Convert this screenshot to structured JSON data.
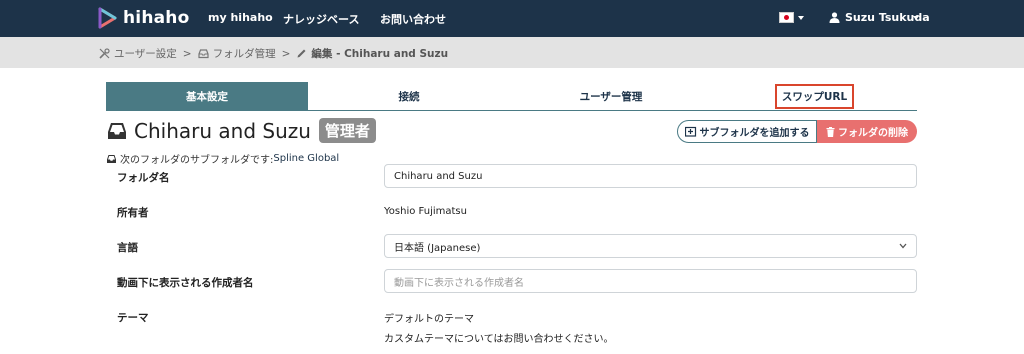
{
  "app": {
    "logo_text": "hihaho"
  },
  "topnav": {
    "links": [
      "my hihaho",
      "ナレッジベース",
      "お問い合わせ"
    ],
    "user_name": "Suzu Tsukuda"
  },
  "breadcrumb": {
    "items": [
      "ユーザー設定",
      "フォルダ管理",
      "編集 - Chiharu and Suzu"
    ]
  },
  "tabs": [
    "基本設定",
    "接続",
    "ユーザー管理",
    "スワップURL"
  ],
  "folder": {
    "title": "Chiharu and Suzu",
    "badge": "管理者",
    "subfolder_prefix": "次のフォルダのサブフォルダです:",
    "parent_folder": "Spline Global",
    "add_subfolder_label": "サブフォルダを追加する",
    "delete_folder_label": "フォルダの削除"
  },
  "form": {
    "folder_name_label": "フォルダ名",
    "folder_name_value": "Chiharu and Suzu",
    "owner_label": "所有者",
    "owner_value": "Yoshio Fujimatsu",
    "language_label": "言語",
    "language_value": "日本語 (Japanese)",
    "author_label": "動画下に表示される作成者名",
    "author_placeholder": "動画下に表示される作成者名",
    "theme_label": "テーマ",
    "theme_value": "デフォルトのテーマ",
    "theme_note": "カスタムテーマについてはお問い合わせください。"
  },
  "colors": {
    "nav_bg": "#1d3349",
    "accent": "#4a7a84",
    "delete": "#e8706f",
    "highlight": "#d9452c"
  }
}
